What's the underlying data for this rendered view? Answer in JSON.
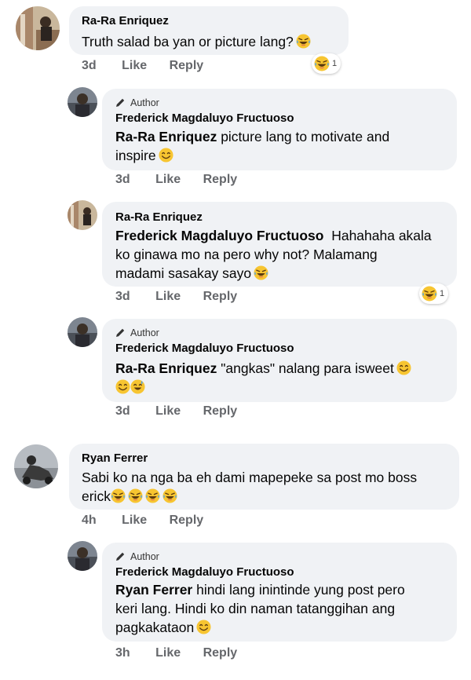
{
  "comments": [
    {
      "author": "Ra-Ra Enriquez",
      "text": "Truth salad ba yan or picture lang?",
      "time": "3d",
      "like": "Like",
      "reply": "Reply",
      "reaction_count": "1"
    },
    {
      "badge": "Author",
      "author": "Frederick Magdaluyo Fructuoso",
      "mention": "Ra-Ra Enriquez",
      "text_l1": " picture lang to motivate and",
      "text_l2": "inspire",
      "time": "3d",
      "like": "Like",
      "reply": "Reply"
    },
    {
      "author": "Ra-Ra Enriquez",
      "mention": "Frederick Magdaluyo Fructuoso",
      "text_l1": "  Hahahaha akala",
      "text_l2": "ko ginawa mo na pero why not? Malamang",
      "text_l3": "madami sasakay sayo",
      "time": "3d",
      "like": "Like",
      "reply": "Reply",
      "reaction_count": "1"
    },
    {
      "badge": "Author",
      "author": "Frederick Magdaluyo Fructuoso",
      "mention": "Ra-Ra Enriquez",
      "text_l1": " \"angkas\" nalang para isweet",
      "time": "3d",
      "like": "Like",
      "reply": "Reply"
    },
    {
      "author": "Ryan Ferrer",
      "text_l1": "Sabi ko na nga ba eh dami mapepeke sa post mo boss",
      "text_l2": "erick",
      "time": "4h",
      "like": "Like",
      "reply": "Reply"
    },
    {
      "badge": "Author",
      "author": "Frederick Magdaluyo Fructuoso",
      "mention": "Ryan Ferrer",
      "text_l1": " hindi lang inintinde yung post pero",
      "text_l2": "keri lang. Hindi ko din naman tatanggihan ang",
      "text_l3": "pagkakataon",
      "time": "3h",
      "like": "Like",
      "reply": "Reply"
    }
  ],
  "icons": {
    "laugh": "face-with-tears-of-joy-icon",
    "smile": "smiling-face-icon",
    "sweat": "grinning-face-with-sweat-icon",
    "author_badge": "pencil-icon"
  },
  "colors": {
    "bubble": "#f0f2f5",
    "meta": "#65676b",
    "emoji": "#f7c531"
  }
}
